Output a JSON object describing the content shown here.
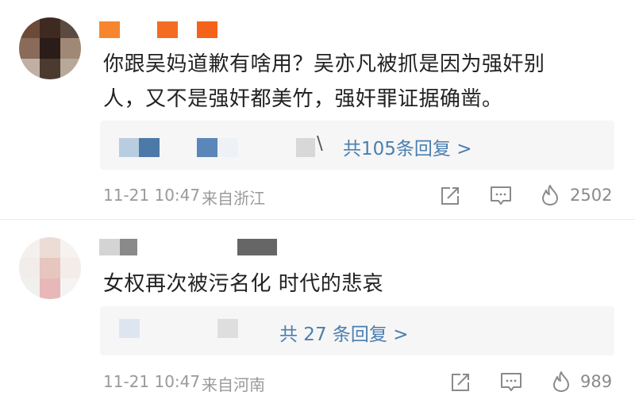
{
  "comments": [
    {
      "text_line1": "你跟吴妈道歉有啥用？吴亦凡被抓是因为强奸别",
      "text_line2": "人，又不是强奸都美竹，强奸罪证据确凿。",
      "reply_link": "共105条回复 >",
      "reply_prefix_char": "\\",
      "timestamp": "11-21 10:47",
      "location": "来自浙江",
      "like_count": "2502",
      "icons": [
        "share-icon",
        "comment-icon",
        "flame-like-icon"
      ],
      "colors": {
        "name_block": "#f36c21"
      }
    },
    {
      "text_line1": "女权再次被污名化 时代的悲哀",
      "reply_link": "共 27 条回复 >",
      "timestamp": "11-21 10:47",
      "location": "来自河南",
      "like_count": "989",
      "icons": [
        "share-icon",
        "comment-icon",
        "flame-like-icon"
      ],
      "colors": {
        "name_block": "#999999"
      }
    }
  ],
  "colors": {
    "link": "#4a7fb0",
    "meta": "#9a9a9a",
    "reply_bg": "#f6f6f6"
  }
}
